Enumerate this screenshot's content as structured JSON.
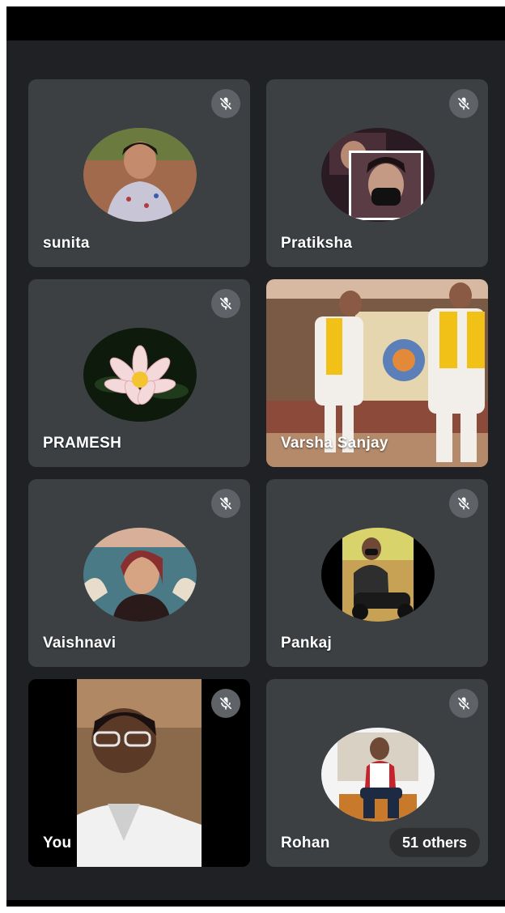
{
  "participants": [
    {
      "name": "sunita",
      "mic_icon": "mic-off-icon"
    },
    {
      "name": "Pratiksha",
      "mic_icon": "mic-off-icon"
    },
    {
      "name": "PRAMESH",
      "mic_icon": "mic-off-icon"
    },
    {
      "name": "Varsha Sanjay"
    },
    {
      "name": "Vaishnavi",
      "mic_icon": "mic-off-icon"
    },
    {
      "name": "Pankaj",
      "mic_icon": "mic-off-icon"
    },
    {
      "name": "You",
      "mic_icon": "mic-off-icon"
    },
    {
      "name": "Rohan",
      "mic_icon": "mic-off-icon"
    }
  ],
  "overflow": {
    "label": "51 others"
  },
  "colors": {
    "background": "#202124",
    "tile": "#3c4043",
    "mic_badge": "#5f6368"
  }
}
